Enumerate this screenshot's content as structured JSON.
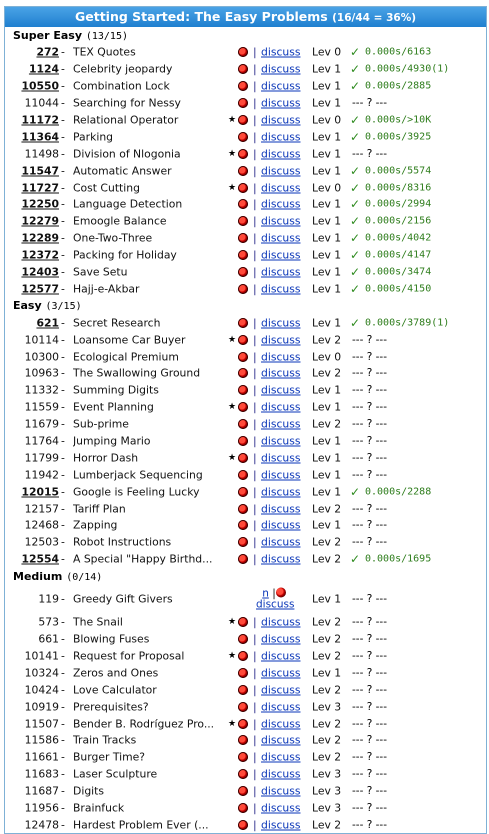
{
  "banner": {
    "title": "Getting Started: The Easy Problems",
    "stats": "(16/44 = 36%)"
  },
  "sections": [
    {
      "name": "Super Easy",
      "count": "(13/15)",
      "rows": [
        {
          "id": "272",
          "title": "TEX Quotes",
          "star": "",
          "discuss": "discuss",
          "lev": "Lev 0",
          "solved": true,
          "result": "0.000s/6163"
        },
        {
          "id": "1124",
          "title": "Celebrity jeopardy",
          "star": "",
          "discuss": "discuss",
          "lev": "Lev 1",
          "solved": true,
          "result": "0.000s/4930(1)"
        },
        {
          "id": "10550",
          "title": "Combination Lock",
          "star": "",
          "discuss": "discuss",
          "lev": "Lev 1",
          "solved": true,
          "result": "0.000s/2885"
        },
        {
          "id": "11044",
          "title": "Searching for Nessy",
          "star": "",
          "discuss": "discuss",
          "lev": "Lev 1",
          "solved": false,
          "result": "--- ? ---"
        },
        {
          "id": "11172",
          "title": "Relational Operator",
          "star": "★",
          "discuss": "discuss",
          "lev": "Lev 0",
          "solved": true,
          "result": "0.000s/>10K"
        },
        {
          "id": "11364",
          "title": "Parking",
          "star": "",
          "discuss": "discuss",
          "lev": "Lev 1",
          "solved": true,
          "result": "0.000s/3925"
        },
        {
          "id": "11498",
          "title": "Division of Nlogonia",
          "star": "★",
          "discuss": "discuss",
          "lev": "Lev 1",
          "solved": false,
          "result": "--- ? ---"
        },
        {
          "id": "11547",
          "title": "Automatic Answer",
          "star": "",
          "discuss": "discuss",
          "lev": "Lev 1",
          "solved": true,
          "result": "0.000s/5574"
        },
        {
          "id": "11727",
          "title": "Cost Cutting",
          "star": "★",
          "discuss": "discuss",
          "lev": "Lev 0",
          "solved": true,
          "result": "0.000s/8316"
        },
        {
          "id": "12250",
          "title": "Language Detection",
          "star": "",
          "discuss": "discuss",
          "lev": "Lev 1",
          "solved": true,
          "result": "0.000s/2994"
        },
        {
          "id": "12279",
          "title": "Emoogle Balance",
          "star": "",
          "discuss": "discuss",
          "lev": "Lev 1",
          "solved": true,
          "result": "0.000s/2156"
        },
        {
          "id": "12289",
          "title": "One-Two-Three",
          "star": "",
          "discuss": "discuss",
          "lev": "Lev 1",
          "solved": true,
          "result": "0.000s/4042"
        },
        {
          "id": "12372",
          "title": "Packing for Holiday",
          "star": "",
          "discuss": "discuss",
          "lev": "Lev 1",
          "solved": true,
          "result": "0.000s/4147"
        },
        {
          "id": "12403",
          "title": "Save Setu",
          "star": "",
          "discuss": "discuss",
          "lev": "Lev 1",
          "solved": true,
          "result": "0.000s/3474"
        },
        {
          "id": "12577",
          "title": "Hajj-e-Akbar",
          "star": "",
          "discuss": "discuss",
          "lev": "Lev 1",
          "solved": true,
          "result": "0.000s/4150"
        }
      ]
    },
    {
      "name": "Easy",
      "count": "(3/15)",
      "rows": [
        {
          "id": "621",
          "title": "Secret Research",
          "star": "",
          "discuss": "discuss",
          "lev": "Lev 1",
          "solved": true,
          "result": "0.000s/3789(1)"
        },
        {
          "id": "10114",
          "title": "Loansome Car Buyer",
          "star": "★",
          "discuss": "discuss",
          "lev": "Lev 2",
          "solved": false,
          "result": "--- ? ---"
        },
        {
          "id": "10300",
          "title": "Ecological Premium",
          "star": "",
          "discuss": "discuss",
          "lev": "Lev 0",
          "solved": false,
          "result": "--- ? ---"
        },
        {
          "id": "10963",
          "title": "The Swallowing Ground",
          "star": "",
          "discuss": "discuss",
          "lev": "Lev 2",
          "solved": false,
          "result": "--- ? ---"
        },
        {
          "id": "11332",
          "title": "Summing Digits",
          "star": "",
          "discuss": "discuss",
          "lev": "Lev 1",
          "solved": false,
          "result": "--- ? ---"
        },
        {
          "id": "11559",
          "title": "Event Planning",
          "star": "★",
          "discuss": "discuss",
          "lev": "Lev 1",
          "solved": false,
          "result": "--- ? ---"
        },
        {
          "id": "11679",
          "title": "Sub-prime",
          "star": "",
          "discuss": "discuss",
          "lev": "Lev 2",
          "solved": false,
          "result": "--- ? ---"
        },
        {
          "id": "11764",
          "title": "Jumping Mario",
          "star": "",
          "discuss": "discuss",
          "lev": "Lev 1",
          "solved": false,
          "result": "--- ? ---"
        },
        {
          "id": "11799",
          "title": "Horror Dash",
          "star": "★",
          "discuss": "discuss",
          "lev": "Lev 1",
          "solved": false,
          "result": "--- ? ---"
        },
        {
          "id": "11942",
          "title": "Lumberjack Sequencing",
          "star": "",
          "discuss": "discuss",
          "lev": "Lev 1",
          "solved": false,
          "result": "--- ? ---"
        },
        {
          "id": "12015",
          "title": "Google is Feeling Lucky",
          "star": "",
          "discuss": "discuss",
          "lev": "Lev 1",
          "solved": true,
          "result": "0.000s/2288"
        },
        {
          "id": "12157",
          "title": "Tariff Plan",
          "star": "",
          "discuss": "discuss",
          "lev": "Lev 2",
          "solved": false,
          "result": "--- ? ---"
        },
        {
          "id": "12468",
          "title": "Zapping",
          "star": "",
          "discuss": "discuss",
          "lev": "Lev 1",
          "solved": false,
          "result": "--- ? ---"
        },
        {
          "id": "12503",
          "title": "Robot Instructions",
          "star": "",
          "discuss": "discuss",
          "lev": "Lev 2",
          "solved": false,
          "result": "--- ? ---"
        },
        {
          "id": "12554",
          "title": "A Special \"Happy Birthd...",
          "star": "",
          "discuss": "discuss",
          "lev": "Lev 2",
          "solved": true,
          "result": "0.000s/1695"
        }
      ]
    },
    {
      "name": "Medium",
      "count": "(0/14)",
      "rows": [
        {
          "id": "119",
          "title": "Greedy Gift Givers",
          "star": "",
          "discuss": "discuss",
          "lev": "Lev 1",
          "solved": false,
          "result": "--- ? ---",
          "tall": true,
          "n": "n"
        },
        {
          "id": "573",
          "title": "The Snail",
          "star": "★",
          "discuss": "discuss",
          "lev": "Lev 2",
          "solved": false,
          "result": "--- ? ---"
        },
        {
          "id": "661",
          "title": "Blowing Fuses",
          "star": "",
          "discuss": "discuss",
          "lev": "Lev 2",
          "solved": false,
          "result": "--- ? ---"
        },
        {
          "id": "10141",
          "title": "Request for Proposal",
          "star": "★",
          "discuss": "discuss",
          "lev": "Lev 2",
          "solved": false,
          "result": "--- ? ---"
        },
        {
          "id": "10324",
          "title": "Zeros and Ones",
          "star": "",
          "discuss": "discuss",
          "lev": "Lev 1",
          "solved": false,
          "result": "--- ? ---"
        },
        {
          "id": "10424",
          "title": "Love Calculator",
          "star": "",
          "discuss": "discuss",
          "lev": "Lev 2",
          "solved": false,
          "result": "--- ? ---"
        },
        {
          "id": "10919",
          "title": "Prerequisites?",
          "star": "",
          "discuss": "discuss",
          "lev": "Lev 3",
          "solved": false,
          "result": "--- ? ---"
        },
        {
          "id": "11507",
          "title": "Bender B. Rodríguez Pro...",
          "star": "★",
          "discuss": "discuss",
          "lev": "Lev 2",
          "solved": false,
          "result": "--- ? ---"
        },
        {
          "id": "11586",
          "title": "Train Tracks",
          "star": "",
          "discuss": "discuss",
          "lev": "Lev 2",
          "solved": false,
          "result": "--- ? ---"
        },
        {
          "id": "11661",
          "title": "Burger Time?",
          "star": "",
          "discuss": "discuss",
          "lev": "Lev 2",
          "solved": false,
          "result": "--- ? ---"
        },
        {
          "id": "11683",
          "title": "Laser Sculpture",
          "star": "",
          "discuss": "discuss",
          "lev": "Lev 3",
          "solved": false,
          "result": "--- ? ---"
        },
        {
          "id": "11687",
          "title": "Digits",
          "star": "",
          "discuss": "discuss",
          "lev": "Lev 3",
          "solved": false,
          "result": "--- ? ---"
        },
        {
          "id": "11956",
          "title": "Brainfuck",
          "star": "",
          "discuss": "discuss",
          "lev": "Lev 3",
          "solved": false,
          "result": "--- ? ---"
        },
        {
          "id": "12478",
          "title": "Hardest Problem Ever (...",
          "star": "",
          "discuss": "discuss",
          "lev": "Lev 2",
          "solved": false,
          "result": "--- ? ---"
        }
      ]
    }
  ],
  "icons": {
    "bug": "ladybug-icon",
    "check": "checkmark-icon",
    "star": "star-icon"
  },
  "colors": {
    "banner": "#1f7fcf",
    "link": "#0a36b8",
    "solved": "#2e8b1f"
  }
}
